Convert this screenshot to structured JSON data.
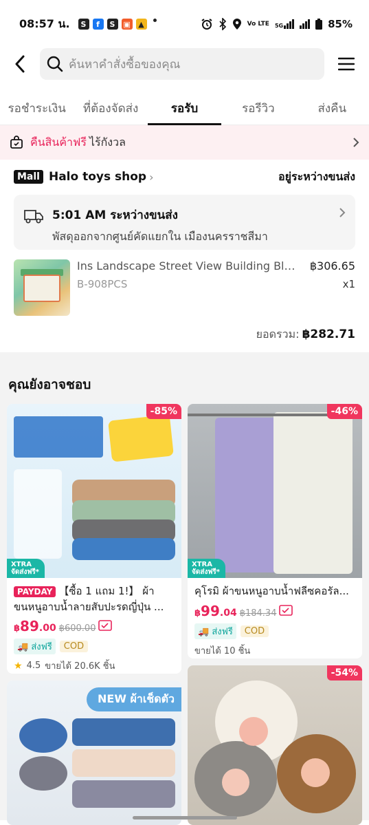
{
  "status_bar": {
    "time": "08:57 น.",
    "apps": [
      "S",
      "f",
      "S",
      "▣",
      "▲"
    ],
    "network": "Vo LTE",
    "signal_label": "5G",
    "battery": "85%"
  },
  "header": {
    "search_placeholder": "ค้นหาคำสั่งซื้อของคุณ"
  },
  "tabs": [
    {
      "label": "รอชำระเงิน",
      "active": false
    },
    {
      "label": "ที่ต้องจัดส่ง",
      "active": false
    },
    {
      "label": "รอรับ",
      "active": true
    },
    {
      "label": "รอรีวิว",
      "active": false
    },
    {
      "label": "ส่งคืน",
      "active": false
    }
  ],
  "promo": {
    "highlight": "คืนสินค้าฟรี",
    "rest": "ไร้กังวล"
  },
  "order": {
    "mall_badge": "Mall",
    "shop_name": "Halo toys shop",
    "shipping_status": "อยู่ระหว่างขนส่ง",
    "tracking_title": "5:01 AM ระหว่างขนส่ง",
    "tracking_detail": "พัสดุออกจากศูนย์คัดแยกใน เมืองนครราชสีมา",
    "product_name": "Ins Landscape Street View Building Block...",
    "variant": "B-908PCS",
    "price": "฿306.65",
    "qty": "x1",
    "total_label": "ยอดรวม:",
    "total_value": "฿282.71"
  },
  "recommend": {
    "title": "คุณยังอาจชอบ",
    "items": [
      {
        "discount": "-85%",
        "xtra": "XTRA",
        "xtra_sub": "จัดส่งฟรี*",
        "promo_tag": "PAYDAY",
        "name": "【ซื้อ 1 แถม 1!】 ผ้าขนหนูอาบน้ำลายสับปะรดญี่ปุ่น ...",
        "currency": "฿",
        "price_int": "89",
        "price_dec": ".00",
        "old_price": "฿600.00",
        "ship": "ส่งฟรี",
        "cod": "COD",
        "rating": "4.5",
        "sold": "ขายได้ 20.6K ชิ้น"
      },
      {
        "discount": "-46%",
        "xtra": "XTRA",
        "xtra_sub": "จัดส่งฟรี*",
        "name": "คุโรมิ ผ้าขนหนูอาบน้ำฟลีซคอรัล...",
        "currency": "฿",
        "price_int": "99",
        "price_dec": ".04",
        "old_price": "฿184.34",
        "ship": "ส่งฟรี",
        "cod": "COD",
        "sold": "ขายได้ 10 ชิ้น"
      },
      {
        "new_badge": "NEW ผ้าเช็ดตัว"
      },
      {
        "discount": "-54%"
      }
    ]
  },
  "colors": {
    "accent": "#e8235a",
    "discount": "#f0365e",
    "teal": "#1bb7a6"
  }
}
